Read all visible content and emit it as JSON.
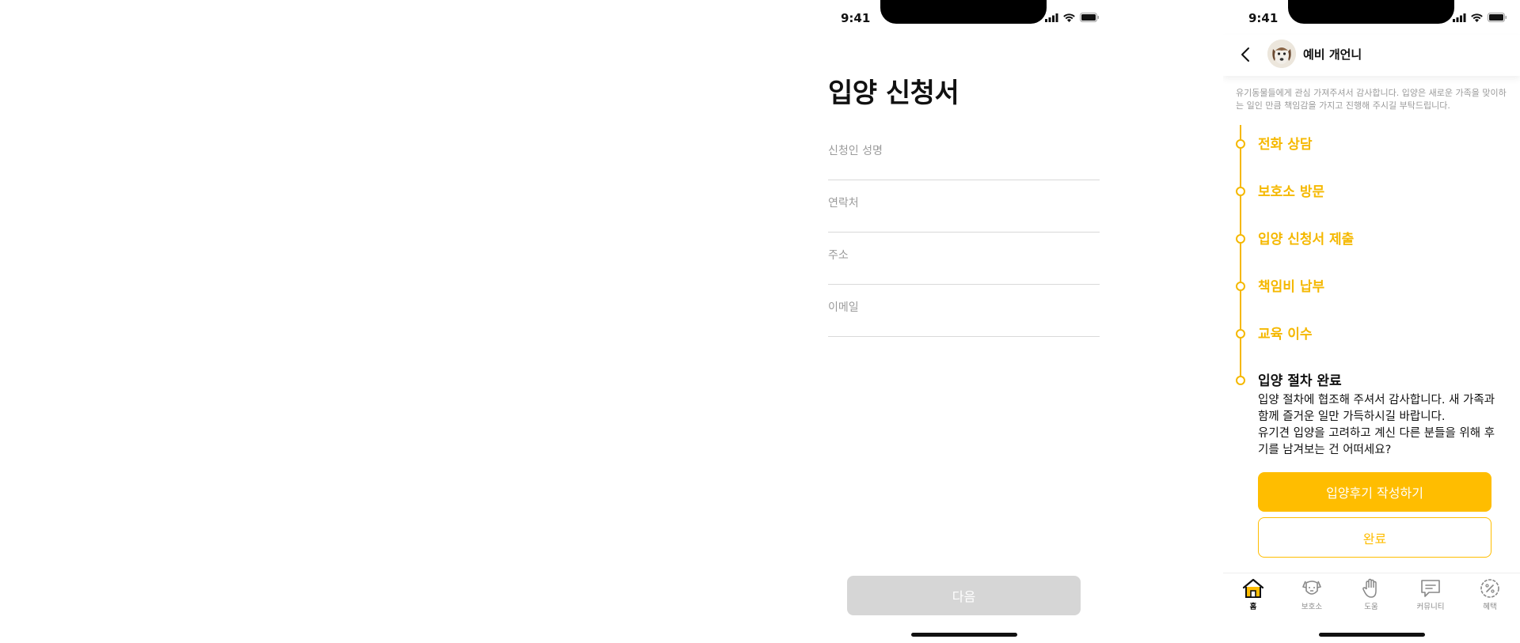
{
  "left_screen": {
    "status_time": "9:41",
    "title": "입양 신청서",
    "fields": [
      {
        "placeholder": "신청인 성명",
        "value": ""
      },
      {
        "placeholder": "연락처",
        "value": ""
      },
      {
        "placeholder": "주소",
        "value": ""
      },
      {
        "placeholder": "이메일",
        "value": ""
      }
    ],
    "next_button": "다음"
  },
  "right_screen": {
    "status_time": "9:41",
    "chat_name": "예비 개언니",
    "intro": "유기동물들에게 관심 가져주셔서 감사합니다. 입양은 새로운 가족을 맞이하는 일인 만큼 책임감을 가지고 진행해 주시길 부탁드립니다.",
    "steps": [
      "전화 상담",
      "보호소 방문",
      "입양 신청서 제출",
      "책임비 납부",
      "교육 이수"
    ],
    "final_step": {
      "title": "입양 절차 완료",
      "body_line1": "입양 절차에 협조해 주셔서 감사합니다. 새 가족과 함께 즐거운 일만 가득하시길 바랍니다.",
      "body_line2": "유기견 입양을 고려하고 계신 다른 분들을 위해 후기를 남겨보는 건 어떠세요?"
    },
    "primary_button": "입양후기 작성하기",
    "secondary_button": "완료",
    "tabs": [
      {
        "label": "홈",
        "icon": "home-icon",
        "active": true
      },
      {
        "label": "보호소",
        "icon": "dog-icon",
        "active": false
      },
      {
        "label": "도움",
        "icon": "hand-icon",
        "active": false
      },
      {
        "label": "커뮤니티",
        "icon": "chat-bubble-icon",
        "active": false
      },
      {
        "label": "혜택",
        "icon": "percent-badge-icon",
        "active": false
      }
    ]
  },
  "colors": {
    "accent": "#ffbd00",
    "disabled_button": "#d6d6d6",
    "divider": "#d9d9d9",
    "muted_text": "#9a9a9a"
  }
}
